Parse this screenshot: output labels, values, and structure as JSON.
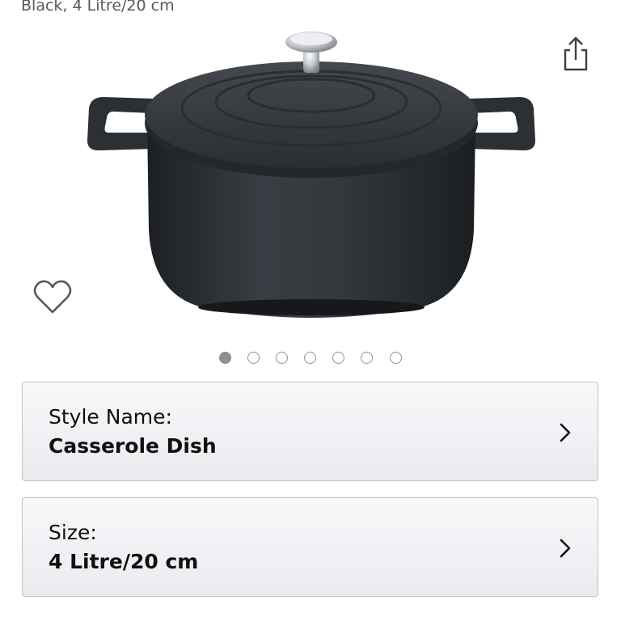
{
  "product": {
    "variant_subtitle": "Black, 4 Litre/20 cm",
    "image_icon": "casserole-pot-image"
  },
  "carousel": {
    "total": 7,
    "active_index": 0
  },
  "actions": {
    "share_icon": "share-icon",
    "wishlist_icon": "heart-outline-icon"
  },
  "variations": [
    {
      "label": "Style Name:",
      "value": "Casserole Dish"
    },
    {
      "label": "Size:",
      "value": "4 Litre/20 cm"
    }
  ],
  "colors": {
    "dot_color": "#8d9096",
    "card_border": "#bfc3c6",
    "text": "#0f1111"
  }
}
